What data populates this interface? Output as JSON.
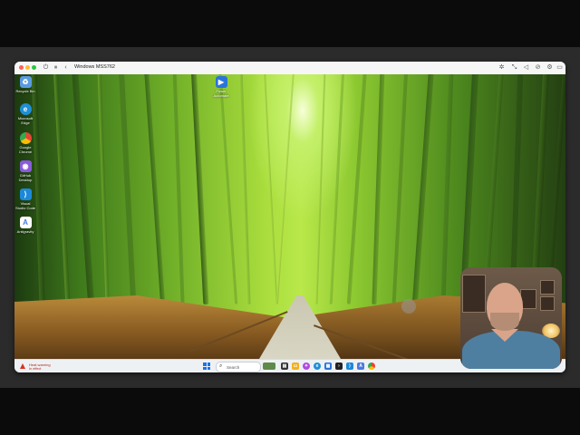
{
  "window": {
    "title": "Windows MSS762"
  },
  "desktop_icons": [
    {
      "label": "Recycle Bin",
      "icon": "recycle-bin-icon",
      "color": "#5a9be0"
    },
    {
      "label": "Microsoft Edge",
      "icon": "edge-icon",
      "color": "#1f8fd6"
    },
    {
      "label": "Google Chrome",
      "icon": "chrome-icon",
      "color": "#34a853"
    },
    {
      "label": "GitHub Desktop",
      "icon": "github-desktop-icon",
      "color": "#8a5cd8"
    },
    {
      "label": "Visual Studio Code",
      "icon": "vscode-icon",
      "color": "#1e88d8"
    },
    {
      "label": "Antigravity",
      "icon": "antigravity-icon",
      "color": "#4a7ae0"
    }
  ],
  "desktop_icon_extra": {
    "label": "Power Automate",
    "icon": "power-automate-icon",
    "color": "#2a74d9"
  },
  "taskbar": {
    "warning_title": "Heat warning",
    "warning_sub": "In effect",
    "search_placeholder": "Search",
    "apps": [
      {
        "icon": "task-view-icon",
        "color": "#333333"
      },
      {
        "icon": "file-explorer-icon",
        "color": "#f2b01e"
      },
      {
        "icon": "copilot-icon",
        "color": "#b04ae0"
      },
      {
        "icon": "edge-icon",
        "color": "#1f8fd6"
      },
      {
        "icon": "store-icon",
        "color": "#2a74d9"
      },
      {
        "icon": "terminal-icon",
        "color": "#222222"
      },
      {
        "icon": "vscode-icon",
        "color": "#1e88d8"
      },
      {
        "icon": "antigravity-icon",
        "color": "#4a7ae0"
      },
      {
        "icon": "chrome-icon",
        "color": "#34a853"
      }
    ]
  },
  "colors": {
    "accent": "#1a73e8",
    "warning": "#d93025"
  }
}
